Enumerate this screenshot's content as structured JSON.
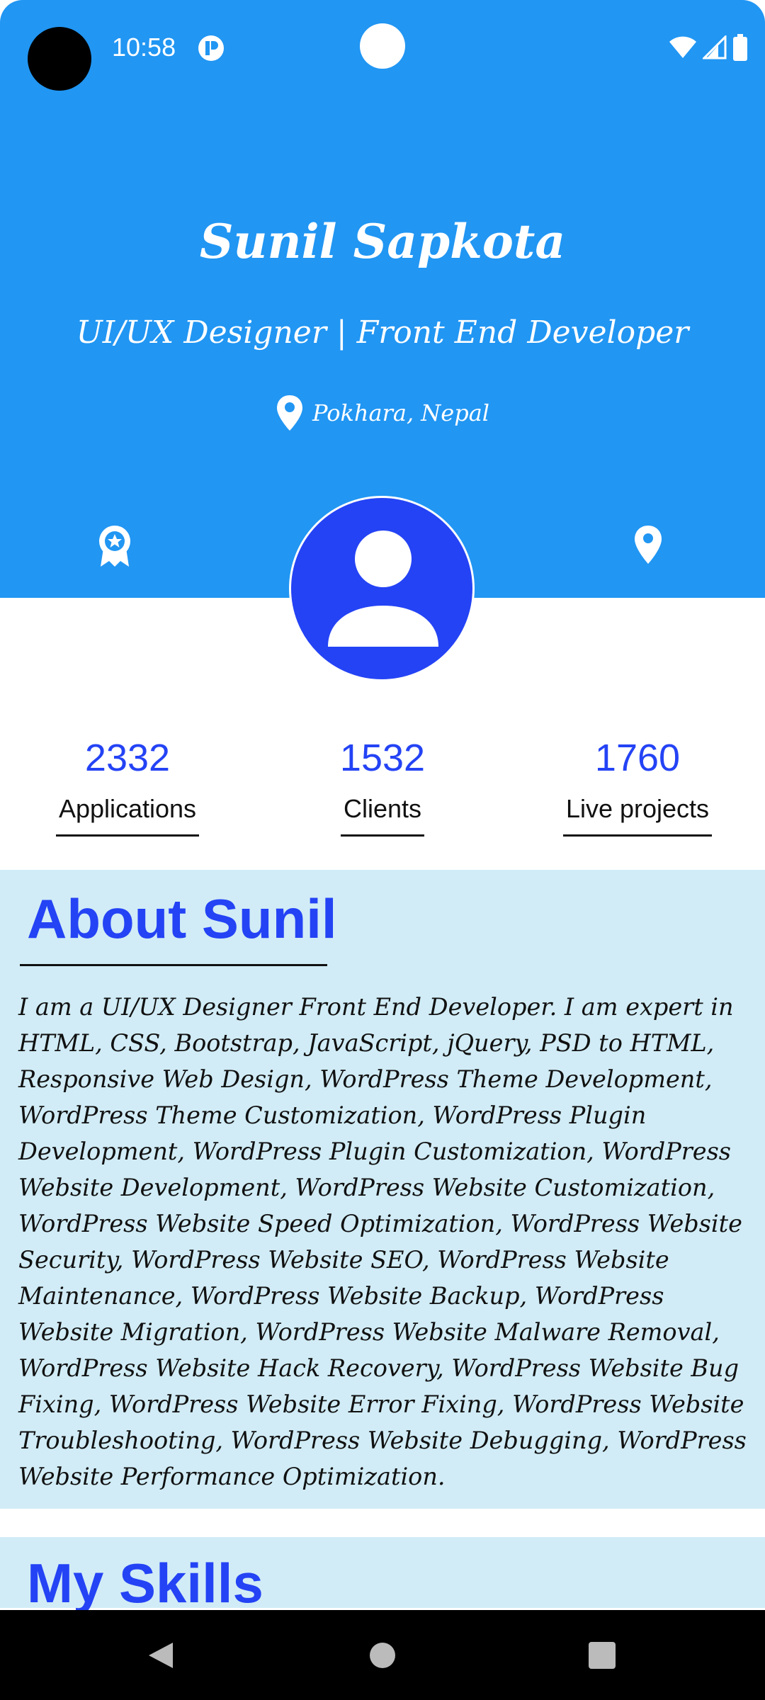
{
  "status_bar": {
    "time": "10:58"
  },
  "profile": {
    "name": "Sunil Sapkota",
    "title": "UI/UX Designer | Front End Developer",
    "location": "Pokhara, Nepal"
  },
  "stats": [
    {
      "value": "2332",
      "label": "Applications"
    },
    {
      "value": "1532",
      "label": "Clients"
    },
    {
      "value": "1760",
      "label": "Live projects"
    }
  ],
  "about": {
    "title": "About Sunil",
    "body": "I am a UI/UX Designer  Front End Developer.  I am expert in HTML, CSS, Bootstrap, JavaScript, jQuery, PSD to HTML, Responsive Web Design, WordPress Theme Development, WordPress Theme Customization, WordPress Plugin Development, WordPress Plugin Customization, WordPress Website Development, WordPress Website Customization, WordPress Website Speed Optimization, WordPress Website Security, WordPress Website SEO, WordPress Website Maintenance, WordPress Website Backup, WordPress Website Migration, WordPress Website Malware Removal, WordPress Website Hack Recovery, WordPress Website Bug Fixing, WordPress Website Error Fixing, WordPress Website Troubleshooting, WordPress Website Debugging, WordPress Website Performance Optimization."
  },
  "skills": {
    "title": "My Skills"
  },
  "colors": {
    "header_blue": "#2196F3",
    "accent_blue": "#2443F5",
    "section_bg": "#D1ECF6"
  },
  "icons": {
    "award": "award-icon",
    "location": "location-pin-icon",
    "avatar": "person-icon",
    "nav_back": "back-triangle-icon",
    "nav_home": "home-circle-icon",
    "nav_recents": "recents-square-icon"
  }
}
